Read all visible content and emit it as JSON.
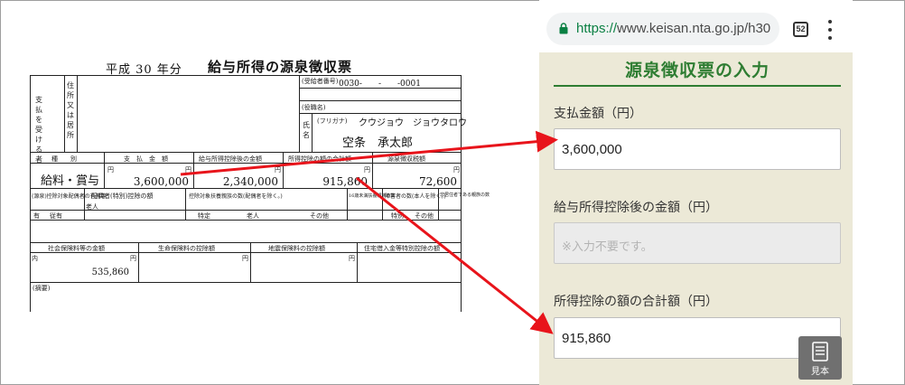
{
  "slip": {
    "year": "平成 30 年分",
    "title": "給与所得の源泉徴収票",
    "recipient_label": "支払を受ける者",
    "address_label": "住所又は居所",
    "recipient_number_label": "(受給者番号)",
    "recipient_number": "0030-　　-　　-0001",
    "position_label": "(役職名)",
    "name_label": "氏名",
    "furigana_label": "(フリガナ)",
    "furigana": "クウジョウ　ジョウタロウ",
    "name": "空条　承太郎",
    "headers": {
      "type": "種　　別",
      "payment": "支　払　金　額",
      "after_deduction": "給与所得控除後の金額",
      "total_deduction": "所得控除の額の合計額",
      "withholding": "源泉徴収税額"
    },
    "type_value": "給料・賞与",
    "payment_value": "3,600,000",
    "after_deduction_value": "2,340,000",
    "total_deduction_value": "915,860",
    "withholding_value": "72,600",
    "unit_yen": "円",
    "row3": {
      "spouse_present": "(源泉)控除対象配偶者の有無等",
      "old_age": "老人",
      "spouse_deduction": "配偶者(特別)控除の額",
      "dependents": "控除対象扶養親族の数(配偶者を除く。)",
      "dependents_16": "16歳未満扶養親族の数",
      "disabled": "障害者の数(本人を除く。)",
      "non_resident": "非居住者である親族の数",
      "have": "有",
      "subordinate": "従有",
      "specific": "特定",
      "old": "老人",
      "other": "その他",
      "special": "特別",
      "person": "人",
      "inner": "内",
      "from": "従人"
    },
    "row4": {
      "social_insurance": "社会保険料等の金額",
      "life_insurance": "生命保険料の控除額",
      "earthquake": "地震保険料の控除額",
      "housing_loan": "住宅借入金等特別控除の額",
      "inner": "内"
    },
    "social_insurance_value": "535,860",
    "remarks_label": "(摘要)"
  },
  "browser": {
    "url_scheme": "https://",
    "url_rest": "www.keisan.nta.go.jp/h30/",
    "tab_count": "52"
  },
  "form": {
    "heading": "源泉徴収票の入力",
    "fields": [
      {
        "label": "支払金額（円）",
        "value": "3,600,000",
        "placeholder": ""
      },
      {
        "label": "給与所得控除後の金額（円）",
        "value": "",
        "placeholder": "※入力不要です。"
      },
      {
        "label": "所得控除の額の合計額（円）",
        "value": "915,860",
        "placeholder": ""
      }
    ],
    "sample_button": "見本"
  },
  "colors": {
    "heading_green": "#2e7d32",
    "arrow_red": "#e8141b",
    "form_bg": "#ece9d7"
  },
  "icons": [
    "lock-icon",
    "tabs-icon",
    "menu-icon",
    "document-icon",
    "arrow-icon"
  ]
}
